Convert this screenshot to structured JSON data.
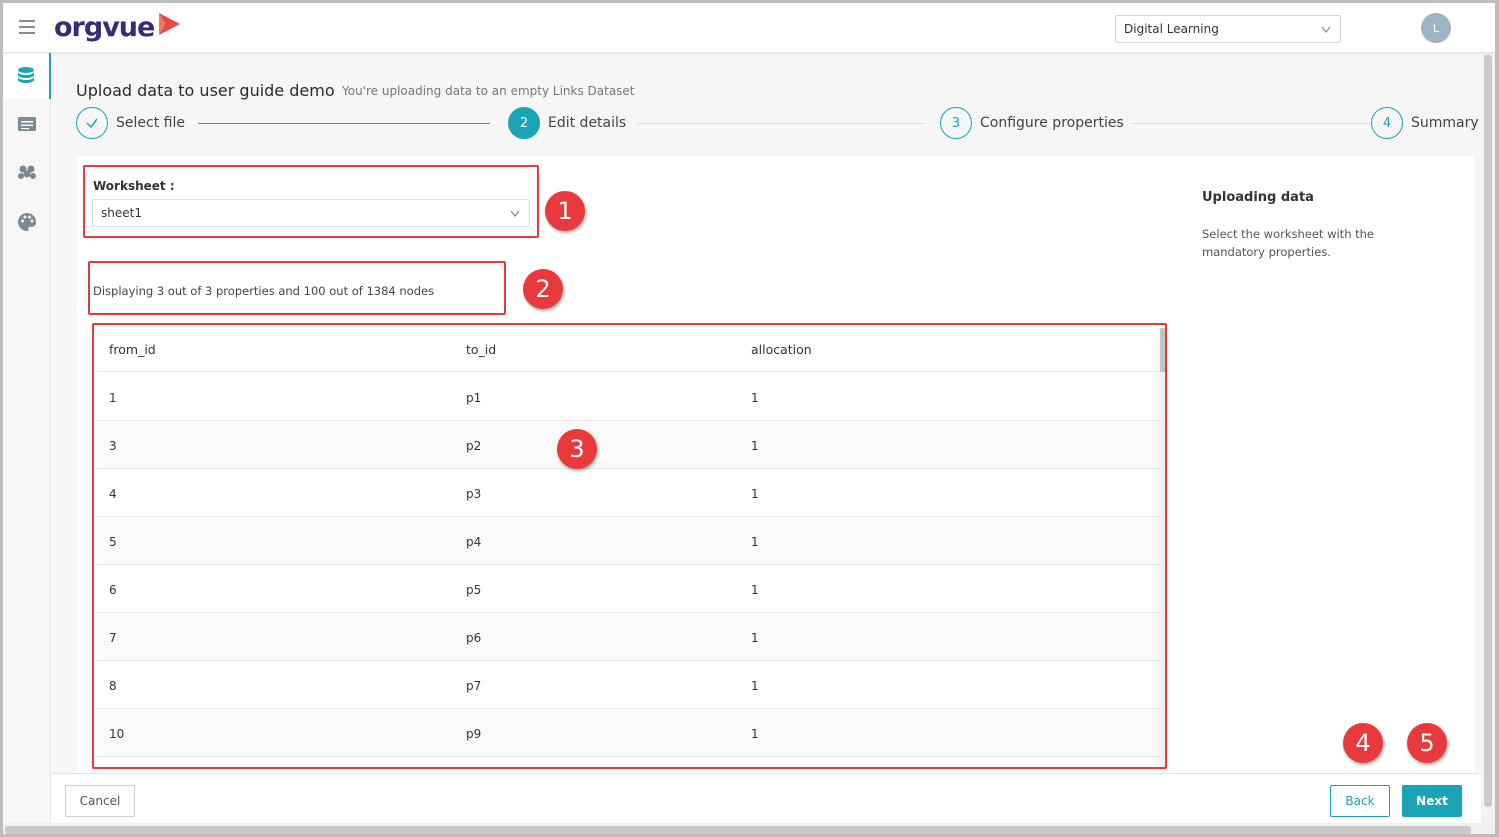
{
  "topbar": {
    "logo_text": "orgvue",
    "dataset_select": "Digital Learning",
    "avatar_initial": "L"
  },
  "page": {
    "title": "Upload data to user guide demo",
    "subtitle": "You're uploading data to an empty Links Dataset"
  },
  "steps": [
    {
      "number": "1",
      "label": "Select file",
      "state": "done"
    },
    {
      "number": "2",
      "label": "Edit details",
      "state": "current"
    },
    {
      "number": "3",
      "label": "Configure properties",
      "state": "pending"
    },
    {
      "number": "4",
      "label": "Summary",
      "state": "pending"
    }
  ],
  "worksheet": {
    "label": "Worksheet",
    "selected": "sheet1"
  },
  "display_text": "Displaying 3 out of 3 properties and 100 out of 1384 nodes",
  "table": {
    "columns": [
      "from_id",
      "to_id",
      "allocation"
    ],
    "rows": [
      [
        "1",
        "p1",
        "1"
      ],
      [
        "3",
        "p2",
        "1"
      ],
      [
        "4",
        "p3",
        "1"
      ],
      [
        "5",
        "p4",
        "1"
      ],
      [
        "6",
        "p5",
        "1"
      ],
      [
        "7",
        "p6",
        "1"
      ],
      [
        "8",
        "p7",
        "1"
      ],
      [
        "10",
        "p9",
        "1"
      ]
    ]
  },
  "help": {
    "title": "Uploading data",
    "description": "Select the worksheet with the mandatory properties."
  },
  "footer": {
    "cancel_label": "Cancel",
    "back_label": "Back",
    "next_label": "Next"
  },
  "annotations": [
    "1",
    "2",
    "3",
    "4",
    "5"
  ],
  "colors": {
    "accent": "#1aa4b5",
    "annotation": "#e8393d",
    "logo": "#3b2a78",
    "logo_mark": "#e8474a"
  }
}
